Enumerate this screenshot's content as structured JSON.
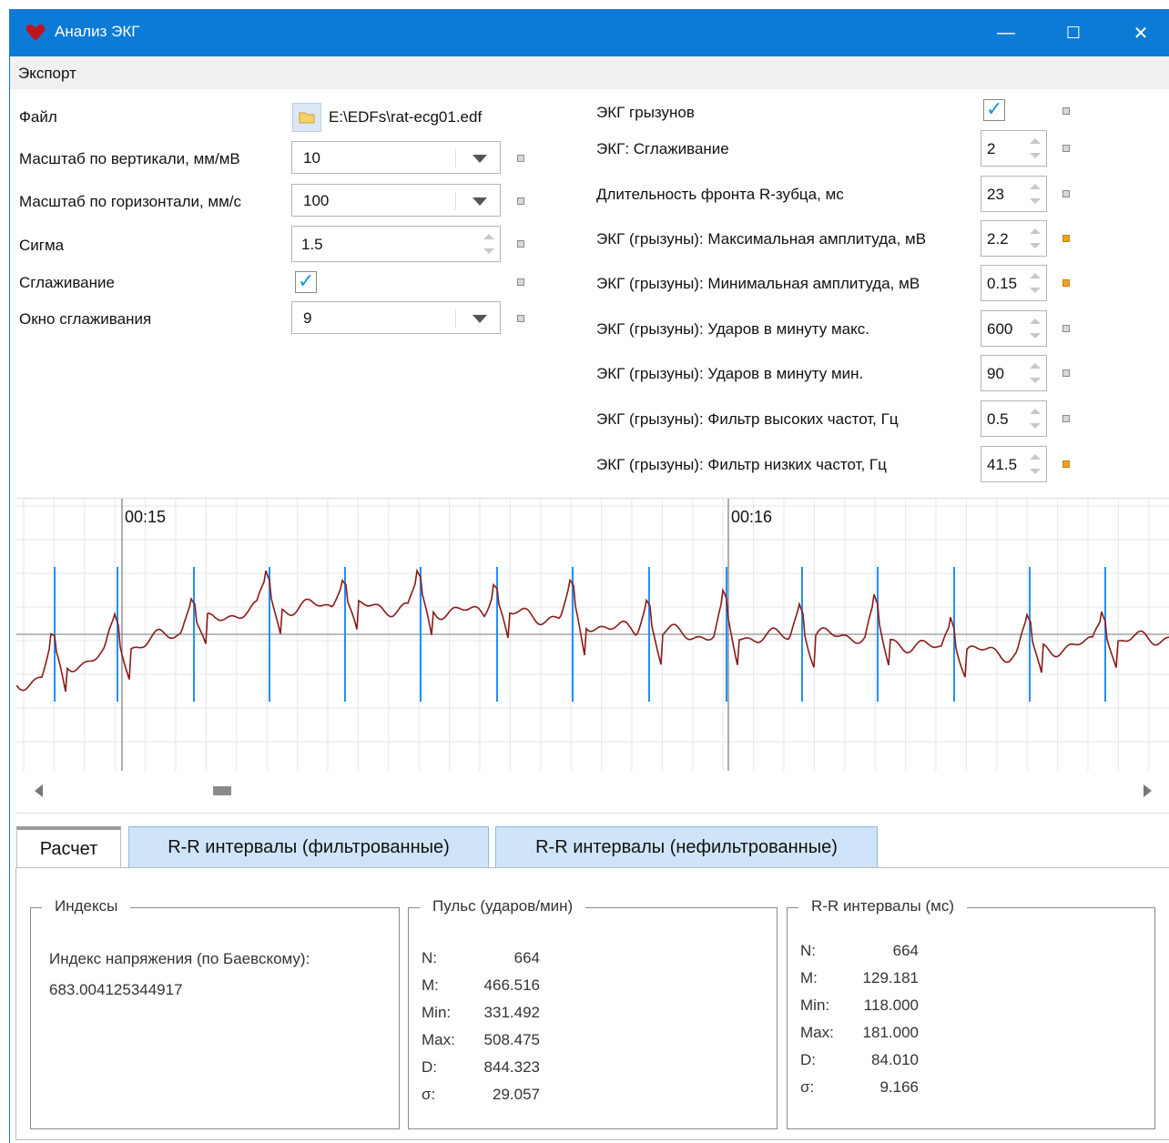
{
  "window": {
    "title": "Анализ ЭКГ",
    "minimize": "—",
    "maximize": "☐",
    "close": "✕"
  },
  "menu": {
    "export": "Экспорт"
  },
  "left": {
    "file_label": "Файл",
    "file_path": "E:\\EDFs\\rat-ecg01.edf",
    "vscale_label": "Масштаб по вертикали, мм/мВ",
    "vscale_value": "10",
    "hscale_label": "Масштаб по горизонтали, мм/с",
    "hscale_value": "100",
    "sigma_label": "Сигма",
    "sigma_value": "1.5",
    "smoothing_label": "Сглаживание",
    "smoothing_checked": true,
    "window_label": "Окно сглаживания",
    "window_value": "9"
  },
  "right": {
    "rodent_label": "ЭКГ грызунов",
    "rodent_checked": true,
    "params": [
      {
        "label": "ЭКГ: Сглаживание",
        "value": "2",
        "mark": "gray"
      },
      {
        "label": "Длительность фронта R-зубца, мс",
        "value": "23",
        "mark": "gray"
      },
      {
        "label": "ЭКГ (грызуны): Максимальная амплитуда, мВ",
        "value": "2.2",
        "mark": "orange"
      },
      {
        "label": "ЭКГ (грызуны): Минимальная амплитуда, мВ",
        "value": "0.15",
        "mark": "orange"
      },
      {
        "label": "ЭКГ (грызуны): Ударов в минуту макс.",
        "value": "600",
        "mark": "gray"
      },
      {
        "label": "ЭКГ (грызуны): Ударов в минуту мин.",
        "value": "90",
        "mark": "gray"
      },
      {
        "label": "ЭКГ (грызуны): Фильтр высоких частот, Гц",
        "value": "0.5",
        "mark": "gray"
      },
      {
        "label": "ЭКГ (грызуны): Фильтр низких частот, Гц",
        "value": "41.5",
        "mark": "orange"
      }
    ]
  },
  "ecg": {
    "time_labels": [
      "00:15",
      "00:16"
    ],
    "colors": {
      "trace": "#8b1a1a",
      "rpeak": "#1e90ff",
      "grid": "#e6e6e6",
      "axis": "#777777"
    }
  },
  "tabs": [
    "Расчет",
    "R-R интервалы (фильтрованные)",
    "R-R интервалы (нефильтрованные)"
  ],
  "indices": {
    "title": "Индексы",
    "stress_label": "Индекс напряжения (по Баевскому):",
    "stress_value": "683.004125344917"
  },
  "pulse": {
    "title": "Пульс (ударов/мин)",
    "rows": [
      {
        "k": "N:",
        "v": "664"
      },
      {
        "k": "M:",
        "v": "466.516"
      },
      {
        "k": "Min:",
        "v": "331.492"
      },
      {
        "k": "Max:",
        "v": "508.475"
      },
      {
        "k": "D:",
        "v": "844.323"
      },
      {
        "k": "σ:",
        "v": "29.057"
      }
    ]
  },
  "rr": {
    "title": "R-R интервалы (мс)",
    "rows": [
      {
        "k": "N:",
        "v": "664"
      },
      {
        "k": "M:",
        "v": "129.181"
      },
      {
        "k": "Min:",
        "v": "118.000"
      },
      {
        "k": "Max:",
        "v": "181.000"
      },
      {
        "k": "D:",
        "v": "84.010"
      },
      {
        "k": "σ:",
        "v": "9.166"
      }
    ]
  }
}
